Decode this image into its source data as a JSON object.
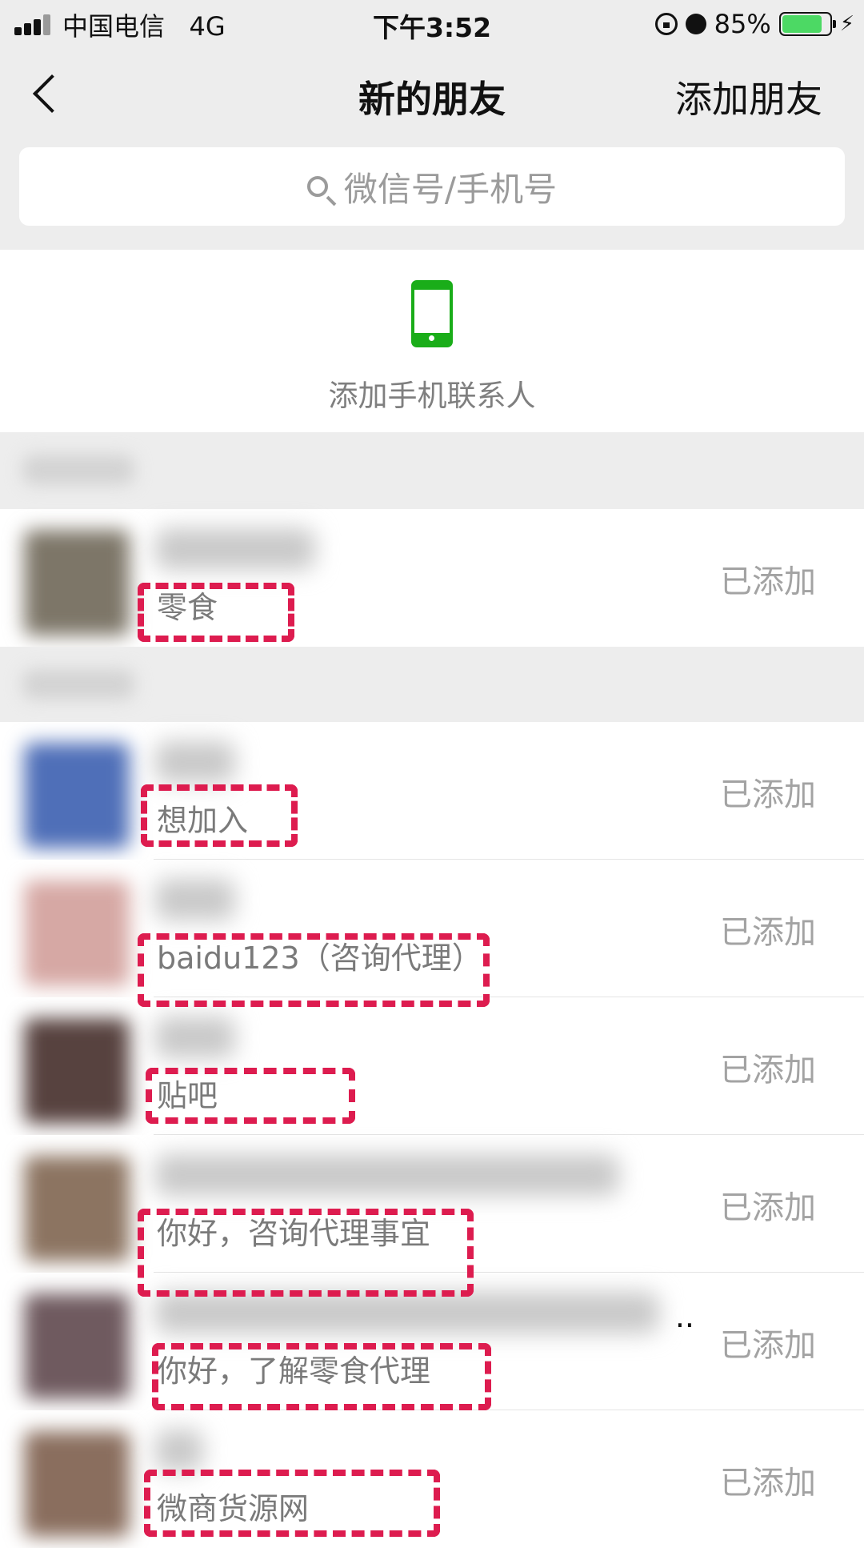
{
  "status_bar": {
    "carrier": "中国电信",
    "network": "4G",
    "time": "下午3:52",
    "battery": "85%",
    "battery_level": 0.85
  },
  "nav": {
    "back_icon": "chevron-left-icon",
    "title": "新的朋友",
    "right_action": "添加朋友"
  },
  "search": {
    "placeholder": "微信号/手机号",
    "icon": "search-icon"
  },
  "phone_contacts": {
    "icon": "phone-icon",
    "label": "添加手机联系人"
  },
  "friend_requests": [
    {
      "message": "零食",
      "status": "已添加"
    },
    {
      "message": "想加入",
      "status": "已添加"
    },
    {
      "message": "baidu123（咨询代理）",
      "status": "已添加"
    },
    {
      "message": "贴吧",
      "status": "已添加"
    },
    {
      "message": "你好，咨询代理事宜",
      "status": "已添加"
    },
    {
      "message": "你好，了解零食代理",
      "status": "已添加"
    },
    {
      "message": "微商货源网",
      "status": "已添加"
    }
  ],
  "colors": {
    "accent_green": "#1aad19",
    "annotation_red": "#dd1c4f",
    "battery_green": "#4cd964",
    "background": "#ededed"
  }
}
